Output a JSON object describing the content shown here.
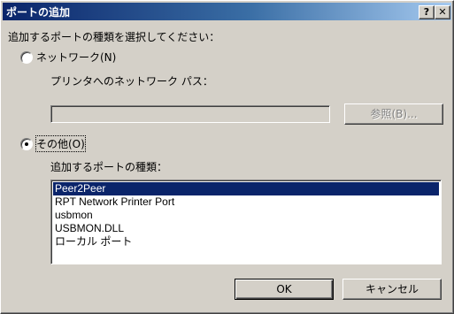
{
  "window": {
    "title": "ポートの追加",
    "help_label": "?",
    "close_label": "✕"
  },
  "prompt": "追加するポートの種類を選択してください：",
  "network_option": {
    "label": "ネットワーク(N)",
    "selected": false,
    "path_label": "プリンタへのネットワーク パス：",
    "path_value": "",
    "browse_label": "参照(B)..."
  },
  "other_option": {
    "label": "その他(O)",
    "selected": true,
    "type_label": "追加するポートの種類："
  },
  "port_types": [
    {
      "label": "Peer2Peer",
      "selected": true
    },
    {
      "label": "RPT Network Printer Port",
      "selected": false
    },
    {
      "label": "usbmon",
      "selected": false
    },
    {
      "label": "USBMON.DLL",
      "selected": false
    },
    {
      "label": "ローカル ポート",
      "selected": false
    }
  ],
  "buttons": {
    "ok_label": "OK",
    "cancel_label": "キャンセル"
  },
  "colors": {
    "titlebar_start": "#0a246a",
    "titlebar_end": "#a6caf0",
    "face": "#d4d0c8",
    "selection": "#0a246a"
  }
}
